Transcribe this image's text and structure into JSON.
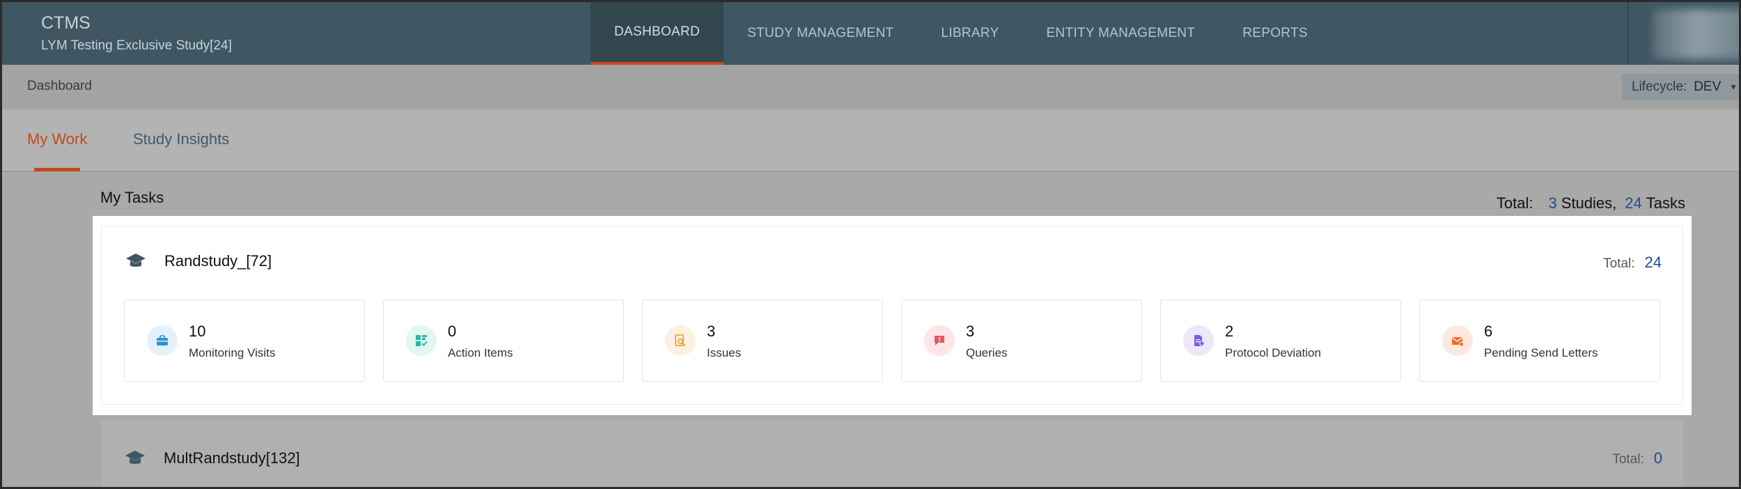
{
  "header": {
    "app_name": "CTMS",
    "study_name": "LYM Testing Exclusive Study[24]",
    "nav": [
      {
        "label": "DASHBOARD",
        "active": true
      },
      {
        "label": "STUDY MANAGEMENT",
        "active": false
      },
      {
        "label": "LIBRARY",
        "active": false
      },
      {
        "label": "ENTITY MANAGEMENT",
        "active": false
      },
      {
        "label": "REPORTS",
        "active": false
      }
    ]
  },
  "subbar": {
    "breadcrumb": "Dashboard",
    "lifecycle_label": "Lifecycle:",
    "lifecycle_value": "DEV"
  },
  "tabs": {
    "my_work": "My Work",
    "study_insights": "Study Insights",
    "active": "My Work"
  },
  "tasks": {
    "title": "My Tasks",
    "total_label": "Total:",
    "studies_count": "3",
    "studies_word": "Studies,",
    "tasks_count": "24",
    "tasks_word": "Tasks"
  },
  "studies": [
    {
      "name": "Randstudy_[72]",
      "total_label": "Total:",
      "total": "24",
      "tiles": [
        {
          "count": "10",
          "label": "Monitoring Visits",
          "icon": "briefcase-icon",
          "color": "#2f8fd8",
          "bg": "#e3f1fb"
        },
        {
          "count": "0",
          "label": "Action Items",
          "icon": "action-items-icon",
          "color": "#2ab7a0",
          "bg": "#e2f6f2"
        },
        {
          "count": "3",
          "label": "Issues",
          "icon": "issues-icon",
          "color": "#e9a33a",
          "bg": "#fcf1e1"
        },
        {
          "count": "3",
          "label": "Queries",
          "icon": "queries-icon",
          "color": "#e25b62",
          "bg": "#fce6e7"
        },
        {
          "count": "2",
          "label": "Protocol Deviation",
          "icon": "protocol-deviation-icon",
          "color": "#7a5fd6",
          "bg": "#ece7fb"
        },
        {
          "count": "6",
          "label": "Pending Send Letters",
          "icon": "letter-icon",
          "color": "#ee6a2f",
          "bg": "#fde8df"
        }
      ]
    },
    {
      "name": "MultRandstudy[132]",
      "total_label": "Total:",
      "total": "0"
    }
  ]
}
